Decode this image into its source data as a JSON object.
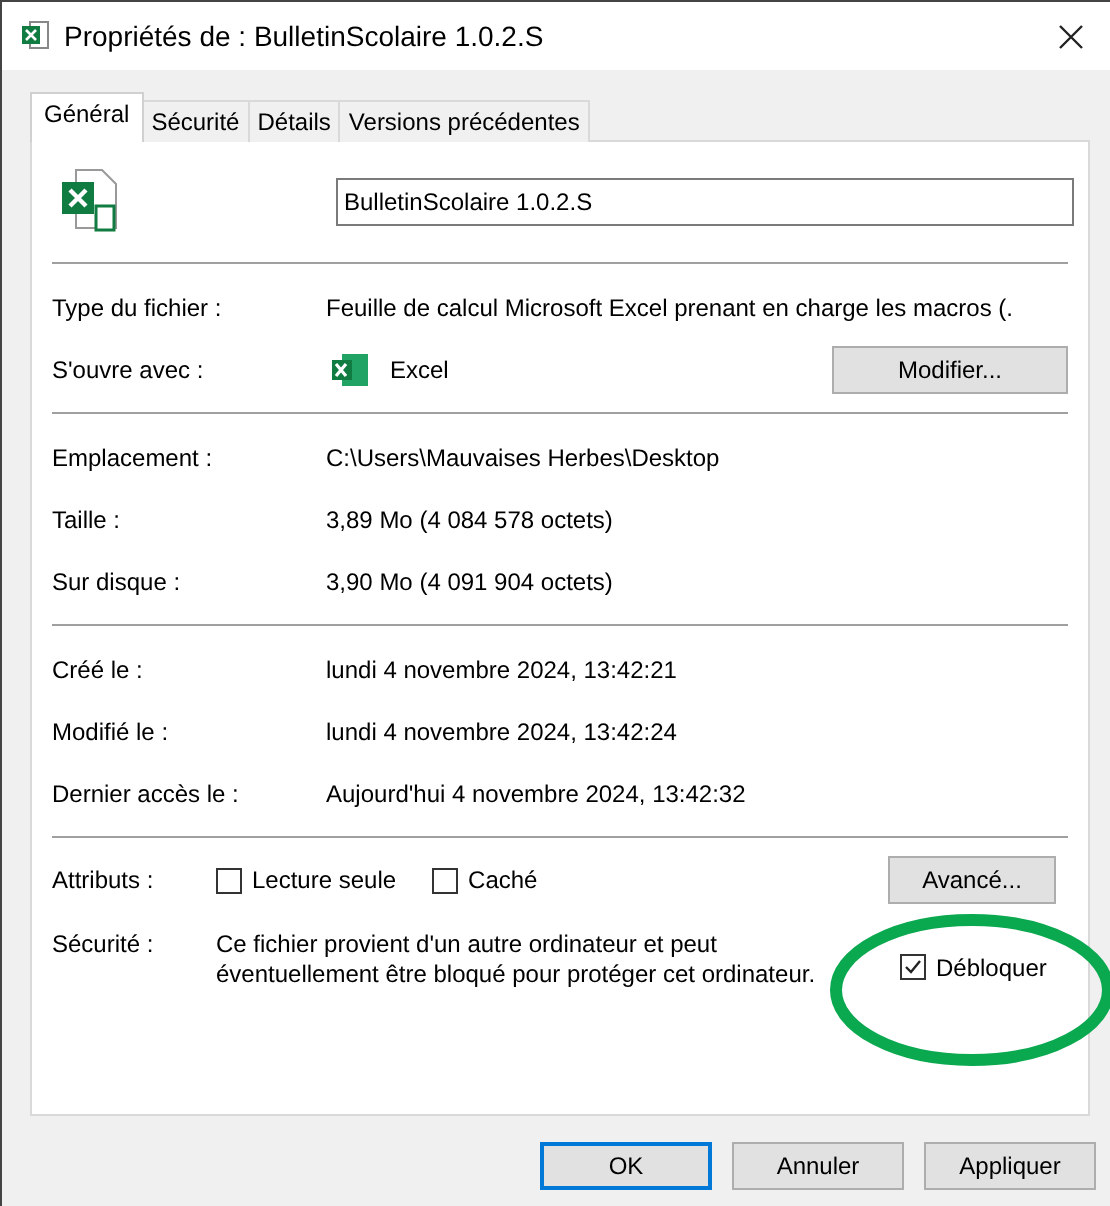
{
  "window": {
    "title": "Propriétés de : BulletinScolaire 1.0.2.S"
  },
  "tabs": [
    {
      "label": "Général",
      "selected": true
    },
    {
      "label": "Sécurité",
      "selected": false
    },
    {
      "label": "Détails",
      "selected": false
    },
    {
      "label": "Versions précédentes",
      "selected": false
    }
  ],
  "file_name": {
    "value": "BulletinScolaire 1.0.2.S"
  },
  "sections": [
    [
      {
        "kind": "text",
        "label": "Type du fichier :",
        "value": "Feuille de calcul Microsoft Excel prenant en charge les macros (."
      },
      {
        "kind": "app",
        "label": "S'ouvre avec :",
        "value": "Excel",
        "button": "Modifier..."
      }
    ],
    [
      {
        "kind": "text",
        "label": "Emplacement :",
        "value": "C:\\Users\\Mauvaises Herbes\\Desktop"
      },
      {
        "kind": "text",
        "label": "Taille :",
        "value": "3,89 Mo (4 084 578 octets)"
      },
      {
        "kind": "text",
        "label": "Sur disque :",
        "value": "3,90 Mo (4 091 904 octets)"
      }
    ],
    [
      {
        "kind": "text",
        "label": "Créé le :",
        "value": "lundi 4 novembre 2024, 13:42:21"
      },
      {
        "kind": "text",
        "label": "Modifié le :",
        "value": "lundi 4 novembre 2024, 13:42:24"
      },
      {
        "kind": "text",
        "label": "Dernier accès le :",
        "value": "Aujourd'hui 4 novembre 2024, 13:42:32"
      }
    ]
  ],
  "attributes": {
    "label": "Attributs :",
    "options": [
      {
        "label": "Lecture seule",
        "checked": false
      },
      {
        "label": "Caché",
        "checked": false
      }
    ],
    "button": "Avancé..."
  },
  "security": {
    "label": "Sécurité :",
    "text": "Ce fichier provient d'un autre ordinateur et peut éventuellement être bloqué pour protéger cet ordinateur.",
    "unblock": {
      "label": "Débloquer",
      "checked": true
    }
  },
  "buttons": [
    {
      "label": "OK",
      "default": true
    },
    {
      "label": "Annuler",
      "default": false
    },
    {
      "label": "Appliquer",
      "default": false
    }
  ]
}
